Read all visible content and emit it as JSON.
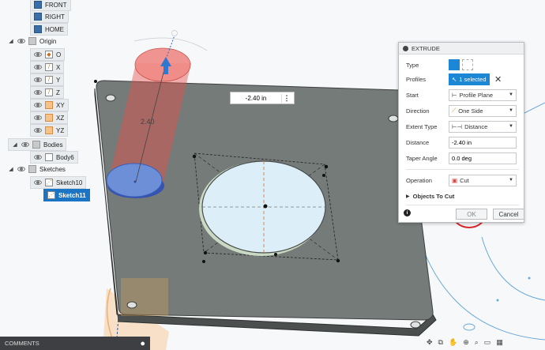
{
  "browser": {
    "views": [
      "FRONT",
      "RIGHT",
      "HOME"
    ],
    "origin": {
      "label": "Origin",
      "items": [
        "O",
        "X",
        "Y",
        "Z",
        "XY",
        "XZ",
        "YZ"
      ]
    },
    "bodies": {
      "label": "Bodies",
      "items": [
        "Body6"
      ]
    },
    "sketches": {
      "label": "Sketches",
      "items": [
        "Sketch10",
        "Sketch11"
      ]
    }
  },
  "canvas": {
    "distance_value": "-2.40 in",
    "dim_label": "2.40"
  },
  "extrude": {
    "title": "EXTRUDE",
    "type_label": "Type",
    "profiles_label": "Profiles",
    "profiles_value": "1 selected",
    "start_label": "Start",
    "start_value": "Profile Plane",
    "direction_label": "Direction",
    "direction_value": "One Side",
    "extent_label": "Extent Type",
    "extent_value": "Distance",
    "distance_label": "Distance",
    "distance_value": "-2.40 in",
    "taper_label": "Taper Angle",
    "taper_value": "0.0 deg",
    "operation_label": "Operation",
    "operation_value": "Cut",
    "objects_label": "Objects To Cut",
    "ok_label": "OK",
    "cancel_label": "Cancel"
  },
  "comments": {
    "label": "COMMENTS"
  }
}
